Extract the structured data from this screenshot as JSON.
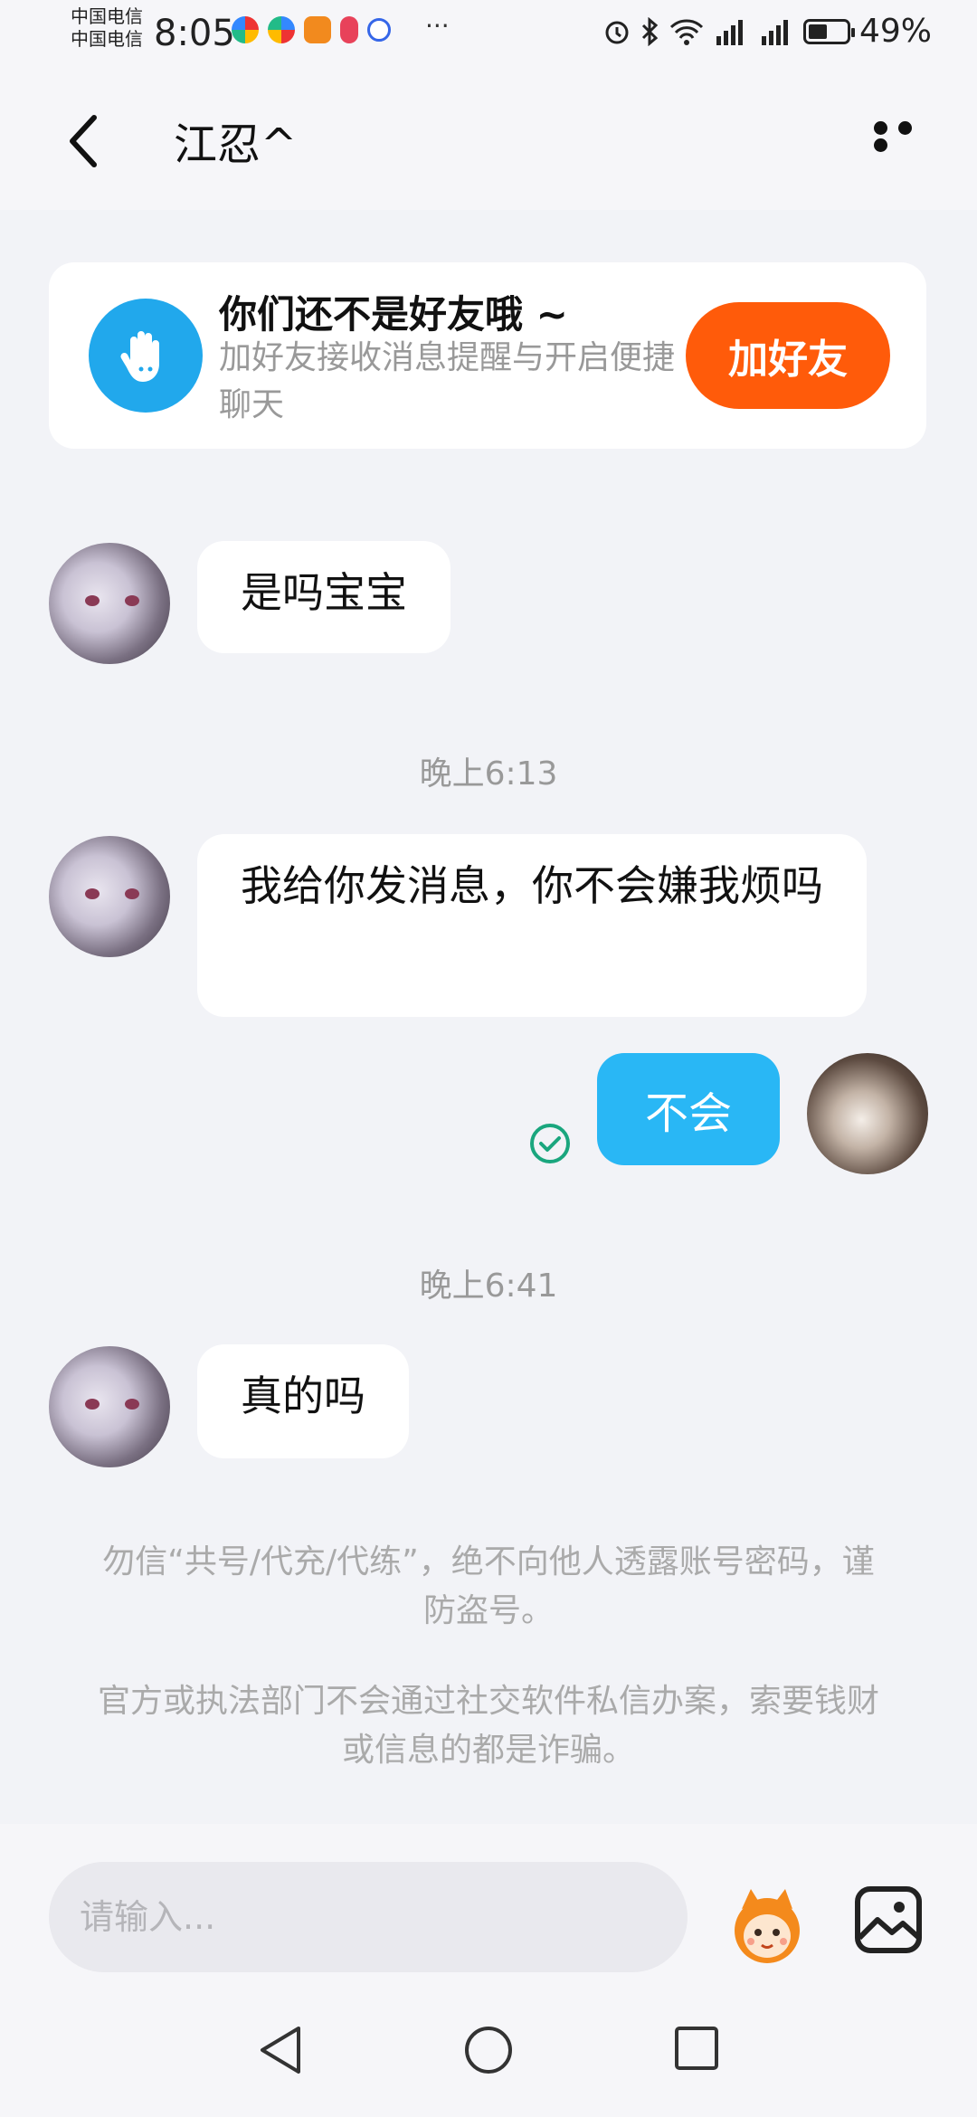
{
  "status_bar": {
    "carrier1": "中国电信",
    "carrier2": "中国电信",
    "time": "8:05",
    "more": "···",
    "battery_percent": "49%",
    "battery_level": 0.49
  },
  "header": {
    "title": "江忍^"
  },
  "friend_card": {
    "title": "你们还不是好友哦 ~",
    "subtitle": "加好友接收消息提醒与开启便捷聊天",
    "add_button": "加好友"
  },
  "messages": [
    {
      "side": "left",
      "text": "是吗宝宝"
    },
    {
      "side": "left",
      "text": "我给你发消息，你不会嫌我烦吗"
    },
    {
      "side": "right",
      "text": "不会"
    },
    {
      "side": "left",
      "text": "真的吗"
    }
  ],
  "time_labels": [
    "晚上6:13",
    "晚上6:41"
  ],
  "notices": [
    "勿信“共号/代充/代练”，绝不向他人透露账号密码，谨防盗号。",
    "官方或执法部门不会通过社交软件私信办案，索要钱财或信息的都是诈骗。"
  ],
  "input": {
    "placeholder": "请输入..."
  },
  "colors": {
    "accent_orange": "#ff5b0a",
    "bubble_blue": "#29b7f5",
    "friend_icon_blue": "#21a8ec",
    "read_green": "#1aa67e"
  }
}
